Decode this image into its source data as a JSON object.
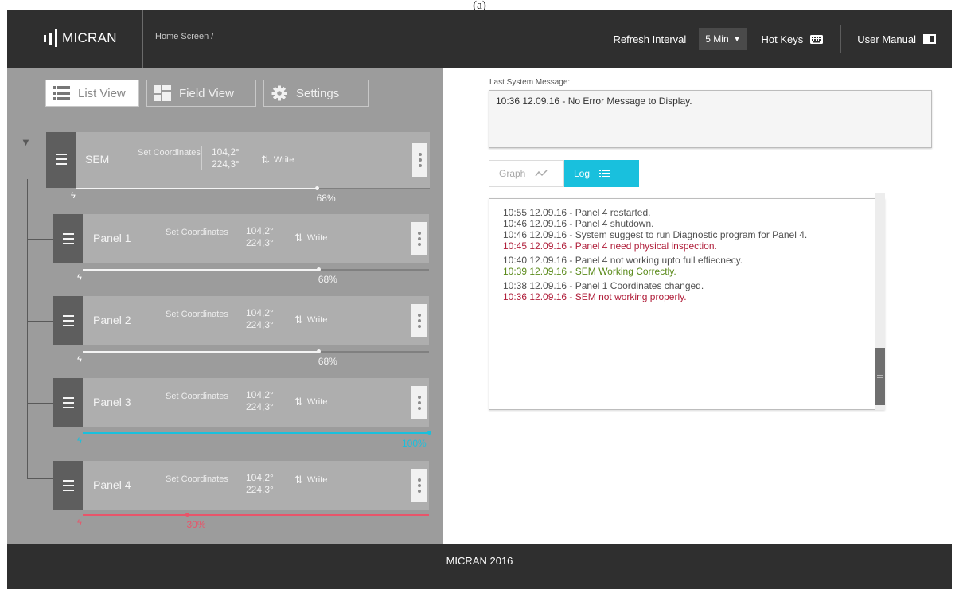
{
  "figure_label": "(a)",
  "header": {
    "logo_text": "MICRAN",
    "breadcrumb": "Home Screen /",
    "refresh_label": "Refresh Interval",
    "refresh_value": "5 Min",
    "hotkeys_label": "Hot Keys",
    "manual_label": "User Manual"
  },
  "views": {
    "list": "List View",
    "field": "Field View",
    "settings": "Settings"
  },
  "devices": [
    {
      "name": "SEM",
      "set_label": "Set Coordinates",
      "coord1": "104,2°",
      "coord2": "224,3°",
      "action": "Write",
      "progress": 68,
      "progress_label": "68%",
      "status": "normal"
    },
    {
      "name": "Panel 1",
      "set_label": "Set Coordinates",
      "coord1": "104,2°",
      "coord2": "224,3°",
      "action": "Write",
      "progress": 68,
      "progress_label": "68%",
      "status": "normal"
    },
    {
      "name": "Panel 2",
      "set_label": "Set Coordinates",
      "coord1": "104,2°",
      "coord2": "224,3°",
      "action": "Write",
      "progress": 68,
      "progress_label": "68%",
      "status": "normal"
    },
    {
      "name": "Panel 3",
      "set_label": "Set Coordinates",
      "coord1": "104,2°",
      "coord2": "224,3°",
      "action": "Write",
      "progress": 100,
      "progress_label": "100%",
      "status": "complete"
    },
    {
      "name": "Panel 4",
      "set_label": "Set Coordinates",
      "coord1": "104,2°",
      "coord2": "224,3°",
      "action": "Write",
      "progress": 30,
      "progress_label": "30%",
      "status": "error"
    }
  ],
  "system_message": {
    "label": "Last System Message:",
    "text": "10:36 12.09.16 - No Error Message to Display."
  },
  "tabs": {
    "graph": "Graph",
    "log": "Log"
  },
  "log": [
    {
      "text": "10:55 12.09.16 - Panel 4 restarted.",
      "level": "info"
    },
    {
      "text": "10:46 12.09.16 - Panel 4 shutdown.",
      "level": "info"
    },
    {
      "text": "10:46 12.09.16 - System suggest to run Diagnostic program for Panel 4.",
      "level": "info"
    },
    {
      "text": "10:45 12.09.16 - Panel 4 need physical inspection.",
      "level": "error"
    },
    {
      "text": "10:40 12.09.16 - Panel 4 not working upto full effiecnecy.",
      "level": "info"
    },
    {
      "text": "10:39 12.09.16 - SEM Working Correctly.",
      "level": "success"
    },
    {
      "text": "10:38 12.09.16 - Panel 1 Coordinates changed.",
      "level": "info"
    },
    {
      "text": "10:36 12.09.16 - SEM not working properly.",
      "level": "error"
    }
  ],
  "footer": "MICRAN 2016",
  "colors": {
    "accent": "#19c0dd",
    "error": "#b01e3a",
    "success": "#5a8a1a",
    "error_bar": "#e8556a",
    "header_bg": "#2f2f2f",
    "panel_bg": "#9c9c9c"
  }
}
